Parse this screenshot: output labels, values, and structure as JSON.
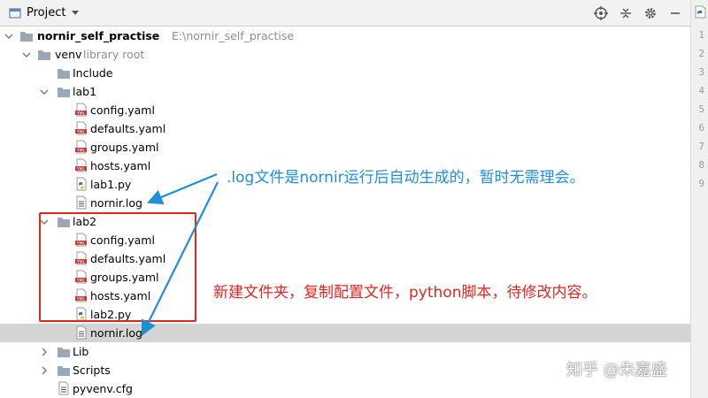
{
  "toolbar": {
    "title": "Project"
  },
  "tree": {
    "root_name": "nornir_self_practise",
    "root_path": "E:\\nornir_self_practise",
    "venv": "venv",
    "venv_hint": "library root",
    "include": "Include",
    "lab1": "lab1",
    "lab1_files": [
      "config.yaml",
      "defaults.yaml",
      "groups.yaml",
      "hosts.yaml",
      "lab1.py",
      "nornir.log"
    ],
    "lab2": "lab2",
    "lab2_files": [
      "config.yaml",
      "defaults.yaml",
      "groups.yaml",
      "hosts.yaml",
      "lab2.py",
      "nornir.log"
    ],
    "lib": "Lib",
    "scripts": "Scripts",
    "pyvenv": "pyvenv.cfg"
  },
  "gutter_lines": [
    "1",
    "2",
    "3",
    "4",
    "5",
    "6",
    "7",
    "8",
    "9"
  ],
  "annotations": {
    "blue": ".log文件是nornir运行后自动生成的，暂时无需理会。",
    "red": "新建文件夹，复制配置文件，python脚本，待修改内容。",
    "watermark": "知乎 @朱嘉盛"
  },
  "colors": {
    "annotation_blue": "#1f8fd6",
    "annotation_red": "#e0261e",
    "selection": "#d4d4d4"
  },
  "icons": {
    "folder": "folder-icon",
    "yaml": "yaml-file-icon",
    "python": "python-file-icon",
    "log": "text-file-icon",
    "locate": "target-icon",
    "collapse": "collapse-all-icon",
    "settings": "gear-icon",
    "hide": "minus-icon"
  }
}
